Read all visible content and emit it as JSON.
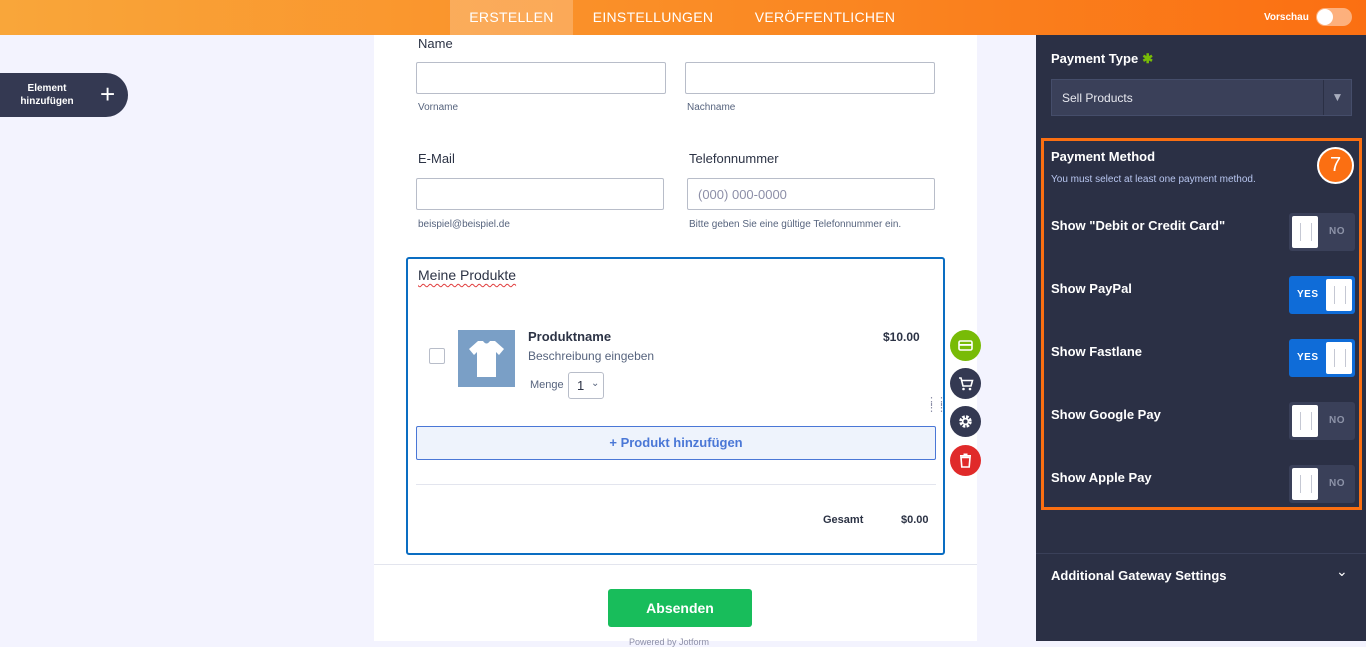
{
  "topbar": {
    "tabs": [
      {
        "label": "ERSTELLEN",
        "active": true
      },
      {
        "label": "EINSTELLUNGEN",
        "active": false
      },
      {
        "label": "VERÖFFENTLICHEN",
        "active": false
      }
    ],
    "preview_label": "Vorschau",
    "preview_enabled": false,
    "gradient_colors": [
      "#f9a63a",
      "#fb6f12"
    ]
  },
  "add_element": {
    "label": "Element hinzufügen",
    "icon": "plus-icon"
  },
  "form": {
    "name": {
      "label": "Name",
      "first_sublabel": "Vorname",
      "last_sublabel": "Nachname"
    },
    "email": {
      "label": "E-Mail",
      "sublabel": "beispiel@beispiel.de"
    },
    "phone": {
      "label": "Telefonnummer",
      "placeholder": "(000) 000-0000",
      "sublabel": "Bitte geben Sie eine gültige Telefonnummer ein."
    },
    "products": {
      "title": "Meine Produkte",
      "item": {
        "name": "Produktname",
        "description": "Beschreibung eingeben",
        "price": "$10.00",
        "qty_label": "Menge",
        "qty_value": "1",
        "image_icon": "tshirt-icon"
      },
      "add_button": "+ Produkt hinzufügen",
      "total_label": "Gesamt",
      "total_value": "$0.00"
    },
    "side_actions": [
      {
        "name": "payment-card-icon",
        "color": "#78bb07"
      },
      {
        "name": "cart-icon",
        "color": "#343952"
      },
      {
        "name": "gear-icon",
        "color": "#343952"
      },
      {
        "name": "trash-icon",
        "color": "#e02a2a"
      }
    ],
    "submit_label": "Absenden",
    "powered_by": "Powered by Jotform"
  },
  "panel": {
    "payment_type_label": "Payment Type",
    "payment_type_value": "Sell Products",
    "payment_method": {
      "title": "Payment Method",
      "subtitle": "You must select at least one payment method.",
      "step_badge": "7",
      "options": [
        {
          "label": "Show \"Debit or Credit Card\"",
          "state": "NO",
          "enabled": false
        },
        {
          "label": "Show PayPal",
          "state": "YES",
          "enabled": true
        },
        {
          "label": "Show Fastlane",
          "state": "YES",
          "enabled": true
        },
        {
          "label": "Show Google Pay",
          "state": "NO",
          "enabled": false
        },
        {
          "label": "Show Apple Pay",
          "state": "NO",
          "enabled": false
        }
      ]
    },
    "gateway_label": "Additional Gateway Settings",
    "highlight_color": "#fb6f12"
  }
}
